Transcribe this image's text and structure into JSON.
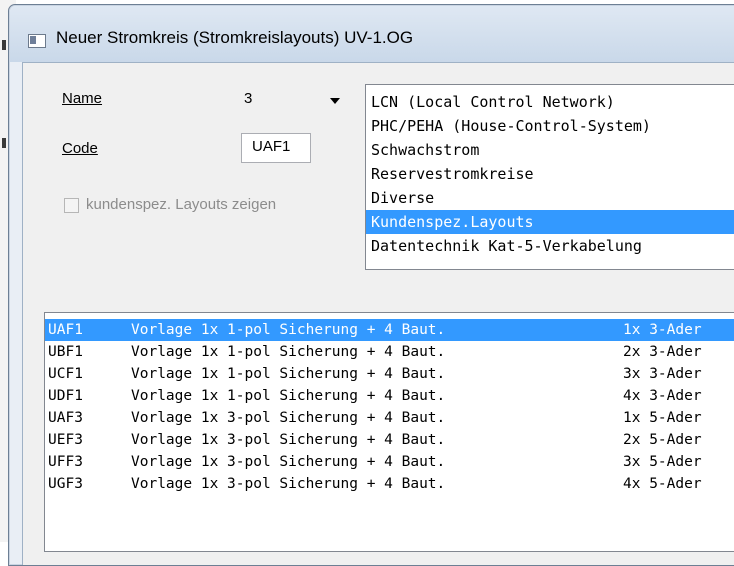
{
  "window": {
    "title": "Neuer Stromkreis (Stromkreislayouts)  UV-1.OG"
  },
  "form": {
    "name_label": "Name",
    "name_value": "3",
    "code_label": "Code",
    "code_value": "UAF1",
    "custom_layouts_checkbox_label": "kundenspez. Layouts zeigen",
    "custom_layouts_checked": false
  },
  "categories": [
    {
      "label": "LCN (Local Control Network)"
    },
    {
      "label": "PHC/PEHA (House-Control-System)"
    },
    {
      "label": "Schwachstrom"
    },
    {
      "label": "Reservestromkreise"
    },
    {
      "label": "Diverse"
    },
    {
      "label": "Kundenspez.Layouts",
      "selected": true
    },
    {
      "label": "Datentechnik Kat-5-Verkabelung"
    }
  ],
  "layouts": [
    {
      "code": "UAF1",
      "desc": "Vorlage 1x 1-pol Sicherung + 4 Baut.",
      "count": "1x 3-Ader",
      "selected": true
    },
    {
      "code": "UBF1",
      "desc": "Vorlage 1x 1-pol Sicherung + 4 Baut.",
      "count": "2x 3-Ader"
    },
    {
      "code": "UCF1",
      "desc": "Vorlage 1x 1-pol Sicherung + 4 Baut.",
      "count": "3x 3-Ader"
    },
    {
      "code": "UDF1",
      "desc": "Vorlage 1x 1-pol Sicherung + 4 Baut.",
      "count": "4x 3-Ader"
    },
    {
      "code": "UAF3",
      "desc": "Vorlage 1x 3-pol Sicherung + 4 Baut.",
      "count": "1x 5-Ader"
    },
    {
      "code": "UEF3",
      "desc": "Vorlage 1x 3-pol Sicherung + 4 Baut.",
      "count": "2x 5-Ader"
    },
    {
      "code": "UFF3",
      "desc": "Vorlage 1x 3-pol Sicherung + 4 Baut.",
      "count": "3x 5-Ader"
    },
    {
      "code": "UGF3",
      "desc": "Vorlage 1x 3-pol Sicherung + 4 Baut.",
      "count": "4x 5-Ader"
    }
  ],
  "colors": {
    "selection": "#3399ff",
    "title_gradient_top": "#dfe8f3",
    "title_gradient_bottom": "#c9d8e9"
  }
}
